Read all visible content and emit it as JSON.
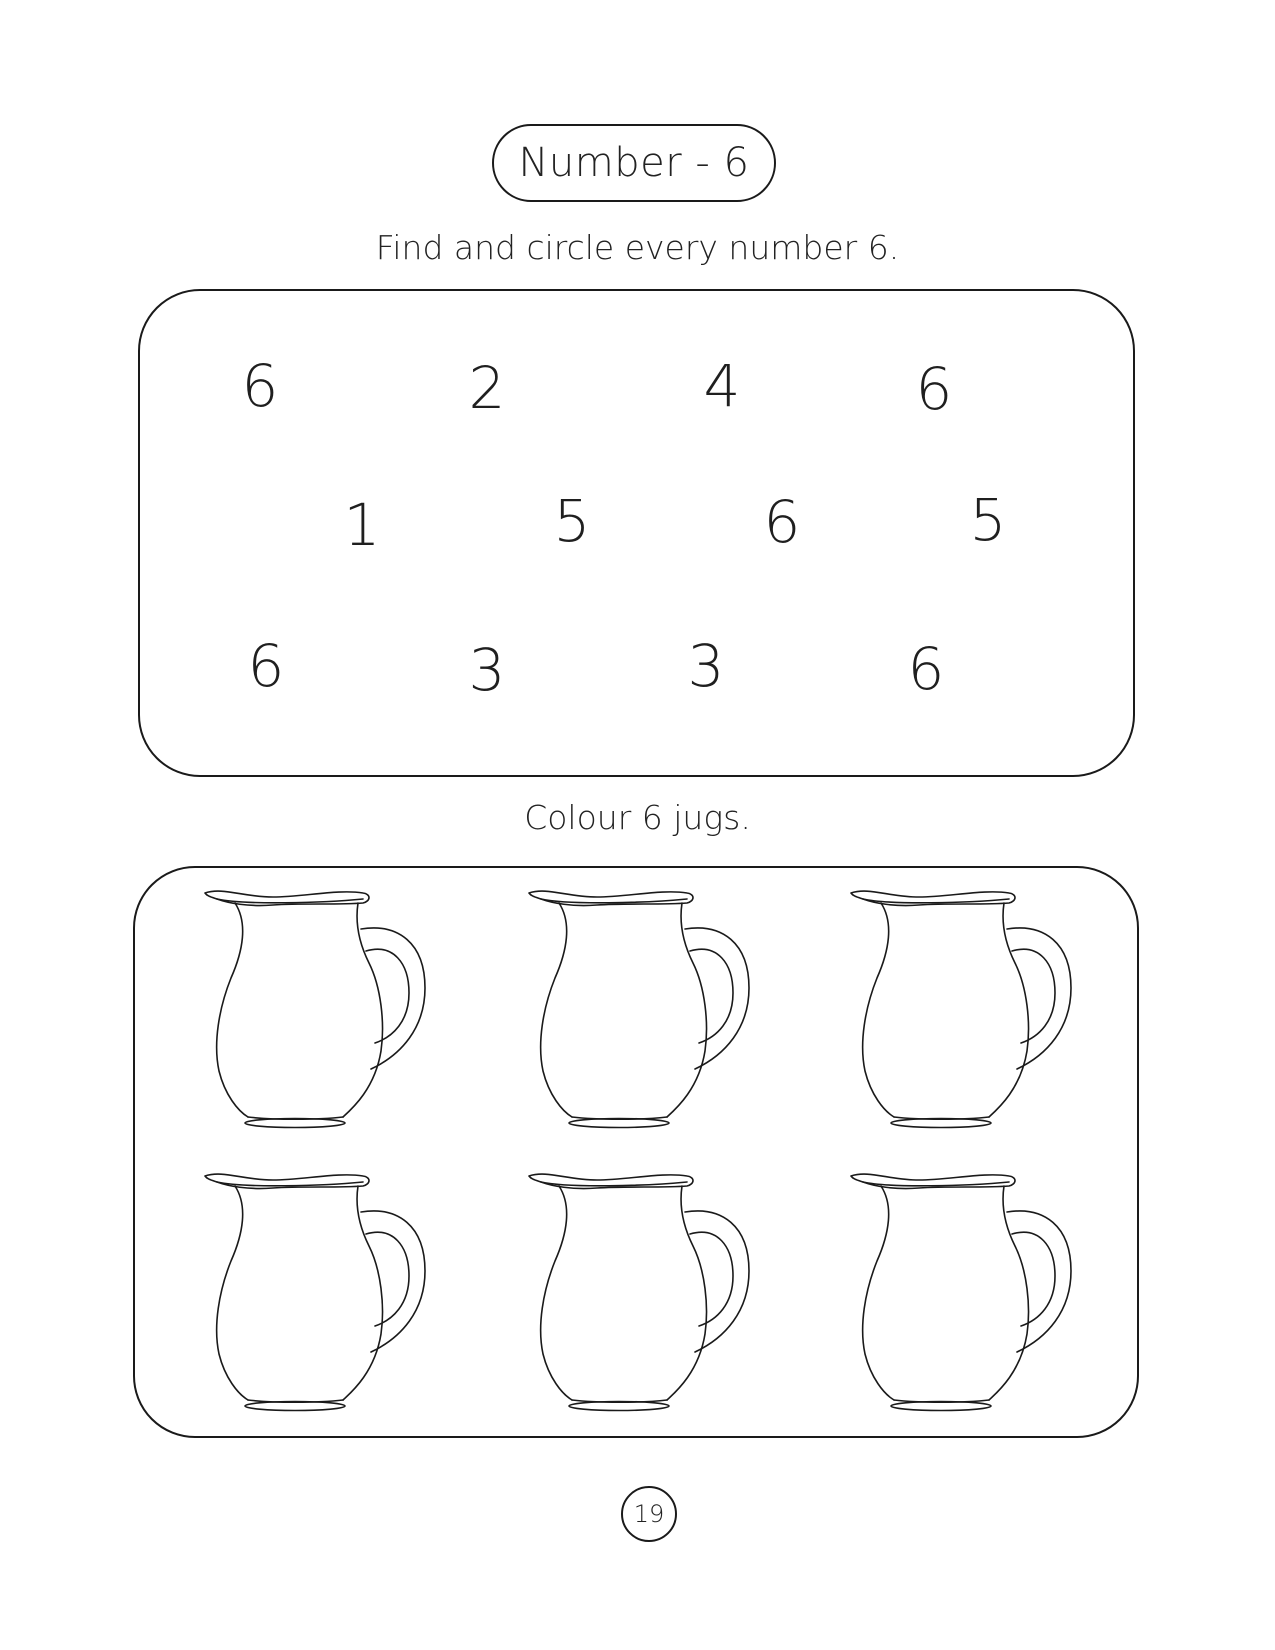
{
  "title": "Number - 6",
  "instructions": {
    "find": "Find and circle every number 6.",
    "colour": "Colour 6 jugs."
  },
  "number_grid": [
    [
      "6",
      "2",
      "4",
      "6"
    ],
    [
      "1",
      "5",
      "6",
      "5"
    ],
    [
      "6",
      "3",
      "3",
      "6"
    ]
  ],
  "jugs": {
    "count": 6,
    "icon": "jug-icon"
  },
  "page_number": "19",
  "colors": {
    "ink": "#1a1a1a",
    "background": "#ffffff"
  }
}
